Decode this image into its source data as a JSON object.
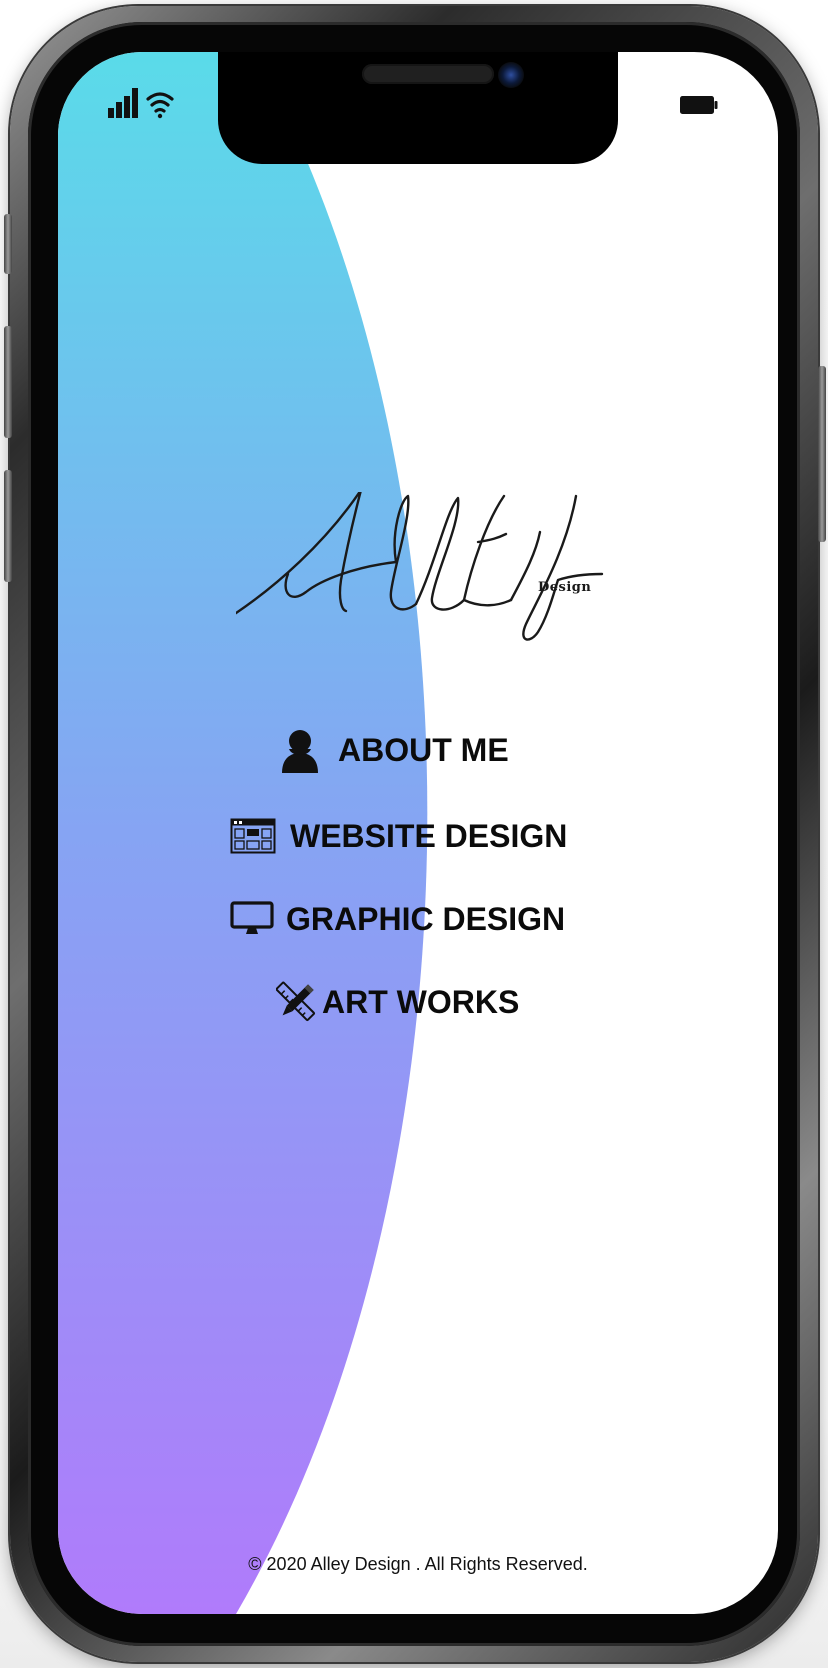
{
  "logo": {
    "text": "ALLEY",
    "subtitle": "Design"
  },
  "menu": [
    {
      "label": "ABOUT ME",
      "icon": "person-icon"
    },
    {
      "label": "WEBSITE DESIGN",
      "icon": "browser-window-icon"
    },
    {
      "label": "GRAPHIC DESIGN",
      "icon": "monitor-icon"
    },
    {
      "label": "ART WORKS",
      "icon": "pencil-ruler-icon"
    }
  ],
  "footer": {
    "copyright": "© 2020 Alley Design . All Rights Reserved."
  },
  "colors": {
    "gradient_top": "#5adbe9",
    "gradient_mid": "#86a4f3",
    "gradient_bottom": "#b07bfb",
    "text": "#0b0b0b"
  }
}
